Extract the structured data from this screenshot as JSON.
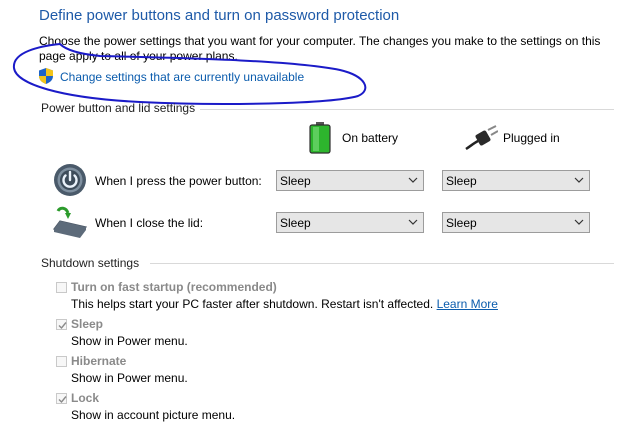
{
  "header": {
    "title": "Define power buttons and turn on password protection",
    "description": "Choose the power settings that you want for your computer. The changes you make to the settings on this page apply to all of your power plans.",
    "change_link": "Change settings that are currently unavailable"
  },
  "power_section": {
    "heading": "Power button and lid settings",
    "columns": {
      "battery": "On battery",
      "plugged": "Plugged in"
    },
    "rows": [
      {
        "label": "When I press the power button:",
        "battery": "Sleep",
        "plugged": "Sleep"
      },
      {
        "label": "When I close the lid:",
        "battery": "Sleep",
        "plugged": "Sleep"
      }
    ]
  },
  "shutdown_section": {
    "heading": "Shutdown settings",
    "options": [
      {
        "label": "Turn on fast startup (recommended)",
        "desc": "This helps start your PC faster after shutdown. Restart isn't affected.",
        "link": "Learn More",
        "checked": false
      },
      {
        "label": "Sleep",
        "desc": "Show in Power menu.",
        "checked": true
      },
      {
        "label": "Hibernate",
        "desc": "Show in Power menu.",
        "checked": false
      },
      {
        "label": "Lock",
        "desc": "Show in account picture menu.",
        "checked": true
      }
    ]
  },
  "colors": {
    "title": "#1e5aa8",
    "link": "#0b5cad",
    "annotation": "#1b1bc8",
    "disabled_text": "#8a8a8a"
  },
  "icons": [
    "shield-icon",
    "battery-icon",
    "plug-icon",
    "power-button-icon",
    "laptop-lid-icon",
    "chevron-down-icon",
    "checkmark-icon"
  ]
}
